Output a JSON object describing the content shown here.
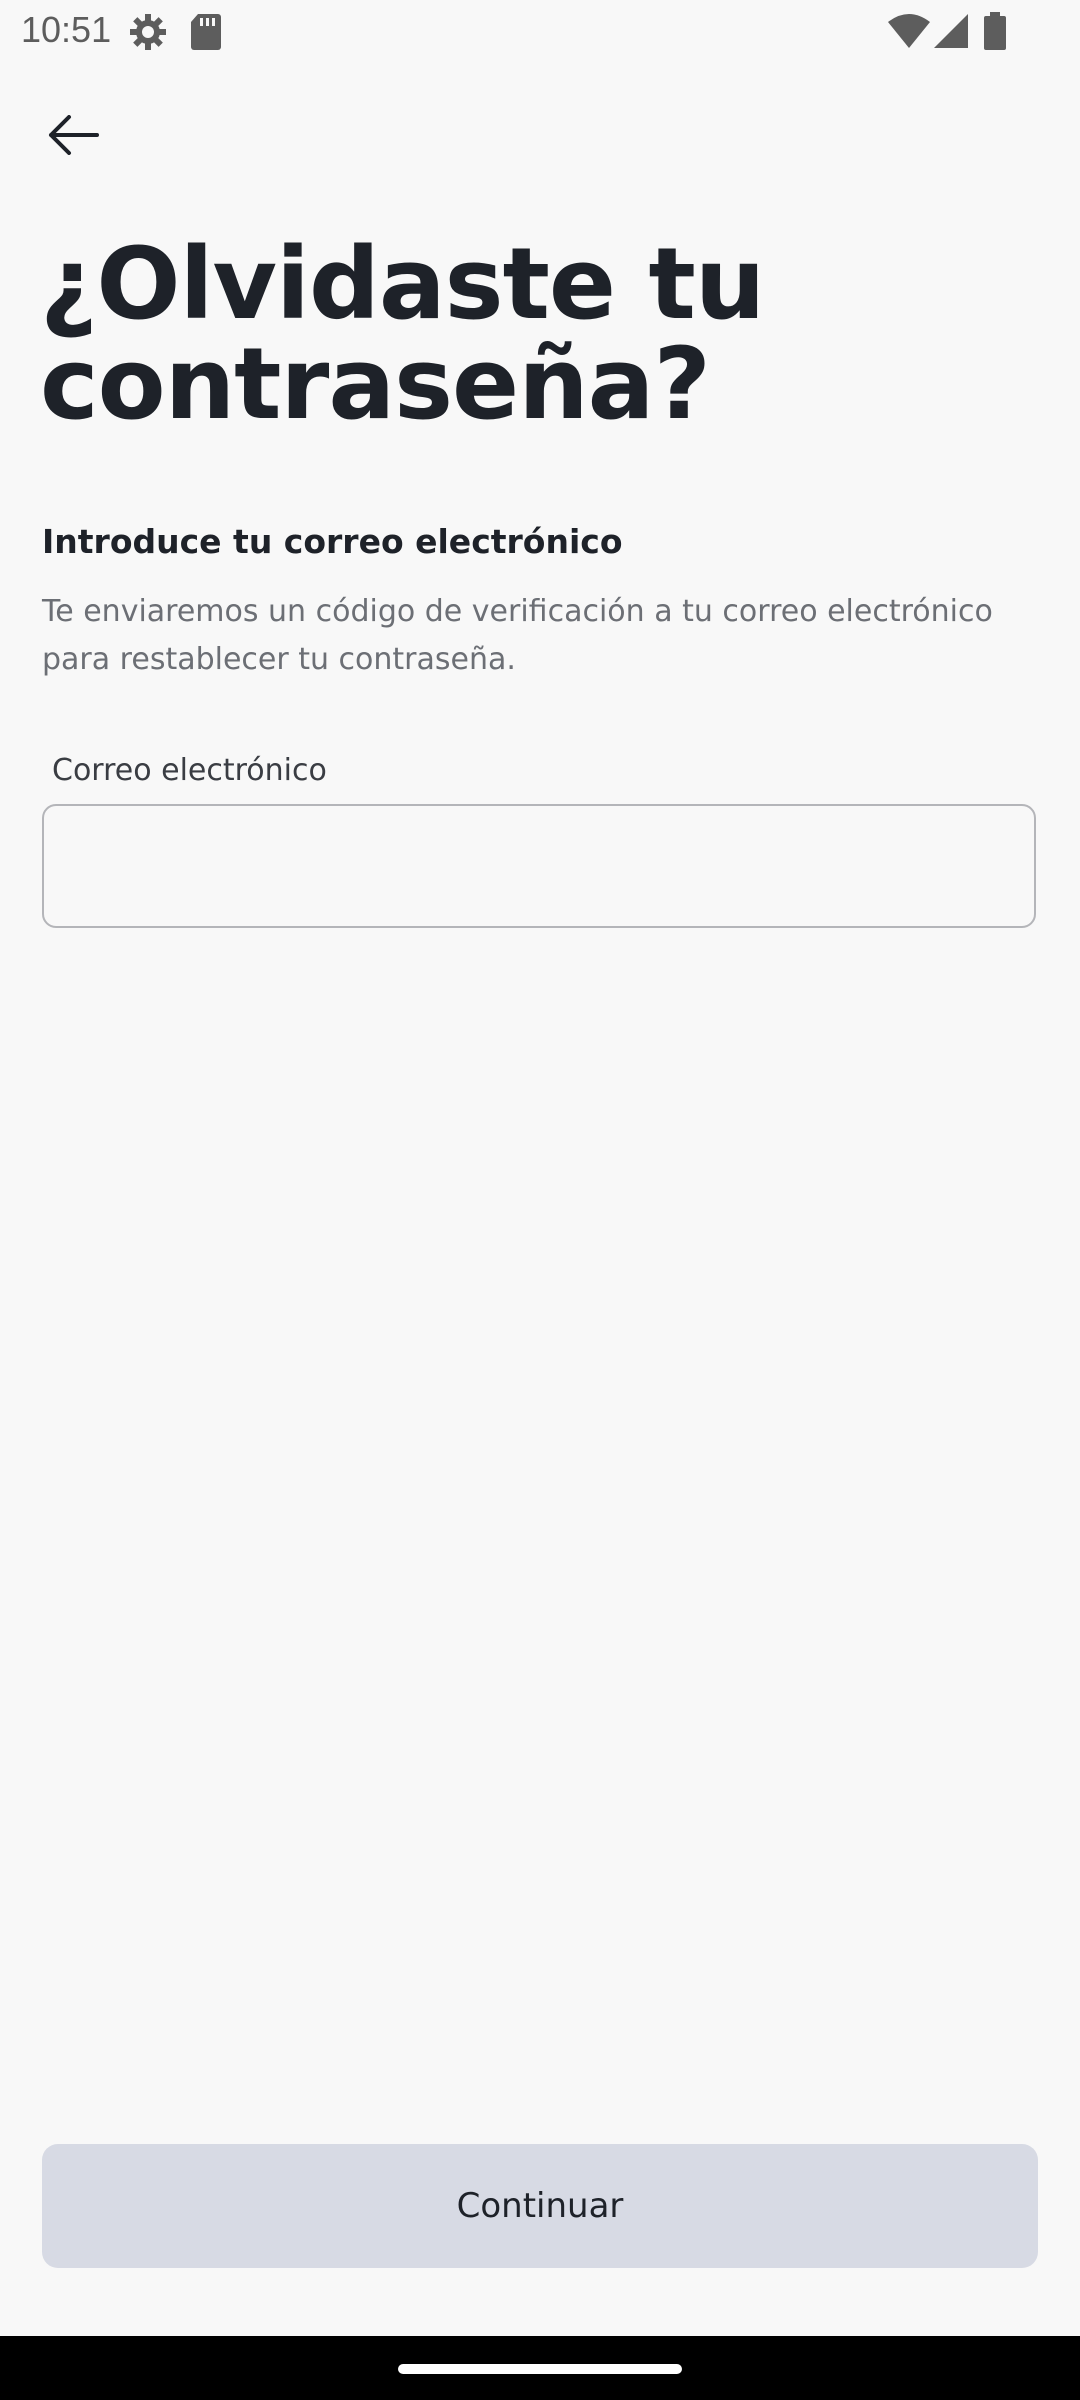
{
  "status_bar": {
    "time": "10:51",
    "icons": [
      "settings-gear-icon",
      "sd-card-icon",
      "wifi-icon",
      "cell-signal-icon",
      "battery-icon"
    ]
  },
  "header": {
    "back_icon": "arrow-left-icon"
  },
  "main": {
    "title": "¿Olvidaste tu contraseña?",
    "heading": "Introduce tu correo electrónico",
    "description": "Te enviaremos un código de verificación a tu correo electrónico para restablecer tu contraseña.",
    "email_label": "Correo electrónico",
    "email_value": "",
    "email_placeholder": ""
  },
  "footer": {
    "continue_label": "Continuar"
  },
  "colors": {
    "background": "#f8f8f8",
    "title_text": "#1e2229",
    "description_text": "#6c6f75",
    "button_disabled_bg": "#d7dae4",
    "input_border": "#b4b5b9"
  }
}
